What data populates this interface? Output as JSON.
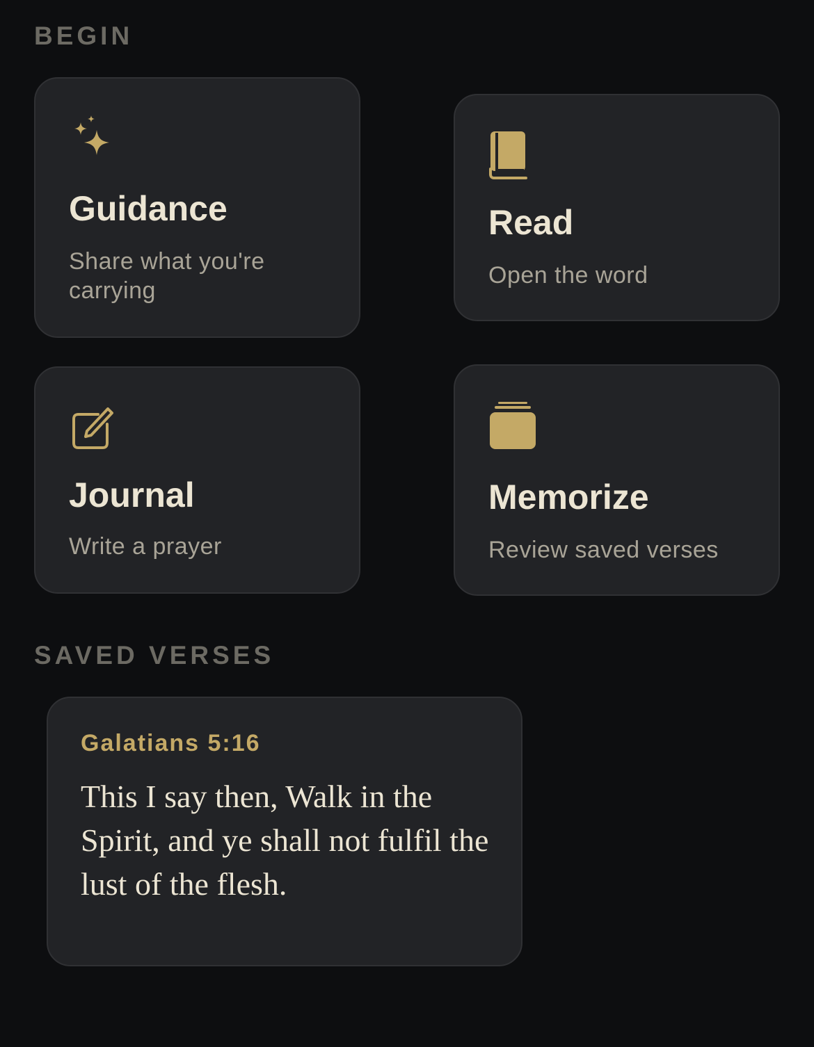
{
  "sections": {
    "begin": "BEGIN",
    "saved_verses": "SAVED VERSES"
  },
  "cards": {
    "guidance": {
      "icon": "sparkles-icon",
      "title": "Guidance",
      "subtitle": "Share what you're carrying"
    },
    "read": {
      "icon": "book-icon",
      "title": "Read",
      "subtitle": "Open the word"
    },
    "journal": {
      "icon": "square-pencil-icon",
      "title": "Journal",
      "subtitle": "Write a prayer"
    },
    "memorize": {
      "icon": "stacked-cards-icon",
      "title": "Memorize",
      "subtitle": "Review saved verses"
    }
  },
  "saved_verses": [
    {
      "reference": "Galatians 5:16",
      "text": "This I say then, Walk in the Spirit, and ye shall not fulfil the lust of the flesh."
    }
  ],
  "colors": {
    "background": "#0d0e10",
    "card": "#222326",
    "accent_gold": "#c4a966",
    "title": "#ece5d3",
    "subtitle": "#a9a497",
    "section_label": "#6c6a63"
  }
}
